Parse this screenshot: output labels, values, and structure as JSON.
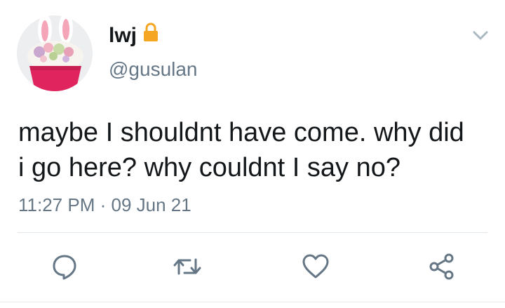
{
  "user": {
    "display_name": "lwj",
    "handle": "@gusulan",
    "protected": true,
    "avatar": "cupcake-with-bunny-ears"
  },
  "tweet": {
    "text_lines": [
      "maybe I shouldnt have come. why did",
      "i go here? why couldnt I say no?"
    ],
    "time": "11:27 PM",
    "separator": "·",
    "date": "09 Jun 21"
  },
  "actions": [
    "reply-icon",
    "retweet-icon",
    "like-icon",
    "share-icon"
  ],
  "colors": {
    "text": "#14171a",
    "secondary": "#657786",
    "icon": "#657786",
    "lock": "#f5a623",
    "divider": "#e1e8ed"
  }
}
